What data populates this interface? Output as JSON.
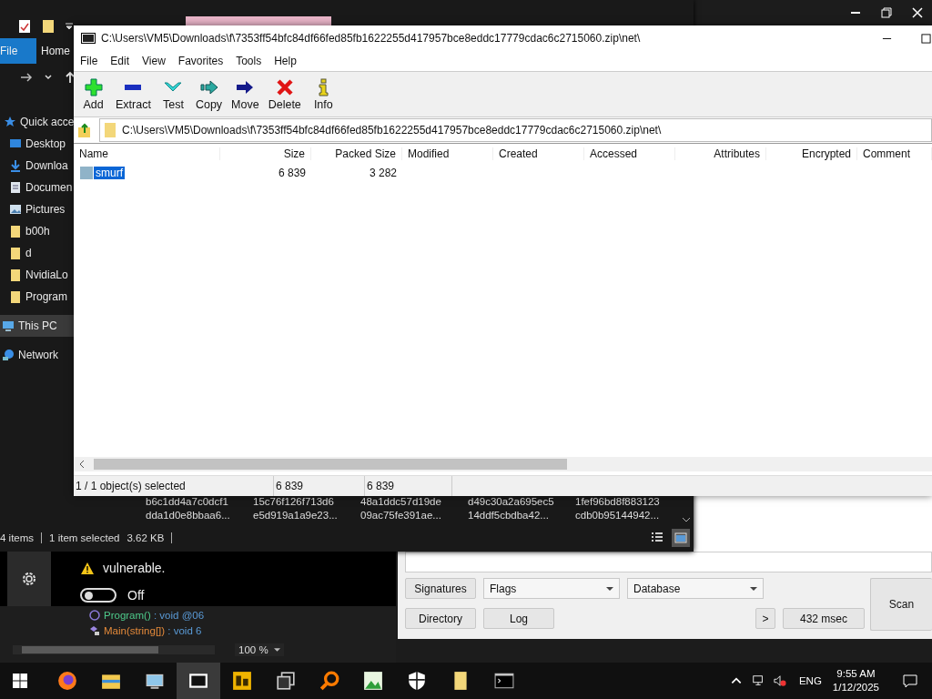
{
  "explorer": {
    "ribbon_tabs": [
      {
        "label": "File",
        "selected": true
      },
      {
        "label": "Home",
        "selected": false
      }
    ],
    "nav_items": [
      {
        "label": "Quick acce",
        "kind": "star",
        "selected": false
      },
      {
        "label": "Desktop",
        "kind": "desktop",
        "selected": false
      },
      {
        "label": "Downloa",
        "kind": "download",
        "selected": false
      },
      {
        "label": "Documen",
        "kind": "document",
        "selected": false
      },
      {
        "label": "Pictures",
        "kind": "pictures",
        "selected": false
      },
      {
        "label": "b00h",
        "kind": "folder",
        "selected": false
      },
      {
        "label": "d",
        "kind": "folder",
        "selected": false
      },
      {
        "label": "NvidiaLo",
        "kind": "folder",
        "selected": false
      },
      {
        "label": "Program",
        "kind": "folder",
        "selected": false
      },
      {
        "label": "This PC",
        "kind": "pc",
        "selected": true
      },
      {
        "label": "Network",
        "kind": "network",
        "selected": false
      }
    ],
    "hash_rows": [
      [
        "b6c1dd4a7c0dcf1",
        "15c76f126f713d6",
        "48a1ddc57d19de",
        "d49c30a2a695ec5",
        "1fef96bd8f883123"
      ],
      [
        "dda1d0e8bbaa6...",
        "e5d919a1a9e23...",
        "09ac75fe391ae...",
        "14ddf5cbdba42...",
        "cdb0b95144942..."
      ]
    ],
    "status_bar": {
      "items": "4 items",
      "selection": "1 item selected",
      "size": "3.62 KB"
    }
  },
  "sevenzip": {
    "title": "C:\\Users\\VM5\\Downloads\\f\\7353ff54bfc84df66fed85fb1622255d417957bce8eddc17779cdac6c2715060.zip\\net\\",
    "menu": [
      "File",
      "Edit",
      "View",
      "Favorites",
      "Tools",
      "Help"
    ],
    "toolbar": [
      {
        "label": "Add",
        "kind": "add"
      },
      {
        "label": "Extract",
        "kind": "extract"
      },
      {
        "label": "Test",
        "kind": "test"
      },
      {
        "label": "Copy",
        "kind": "copy"
      },
      {
        "label": "Move",
        "kind": "move"
      },
      {
        "label": "Delete",
        "kind": "delete"
      },
      {
        "label": "Info",
        "kind": "info"
      }
    ],
    "address": "C:\\Users\\VM5\\Downloads\\f\\7353ff54bfc84df66fed85fb1622255d417957bce8eddc17779cdac6c2715060.zip\\net\\",
    "columns": [
      "Name",
      "Size",
      "Packed Size",
      "Modified",
      "Created",
      "Accessed",
      "Attributes",
      "Encrypted",
      "Comment"
    ],
    "rows": [
      {
        "name": "smurf",
        "size": "6 839",
        "packed_size": "3 282",
        "selected": true
      }
    ],
    "status_bar": [
      "1 / 1 object(s) selected",
      "6 839",
      "6 839"
    ]
  },
  "defender": {
    "message": "vulnerable.",
    "toggle": {
      "label": "Off",
      "on": false
    }
  },
  "editor": {
    "lines": [
      {
        "name": "Program()",
        "signature": " : void @06",
        "kind": "constructor"
      },
      {
        "name": "Main(string[])",
        "signature": " : void 6",
        "kind": "method"
      }
    ],
    "zoom": "100 %"
  },
  "scanner": {
    "signatures": "Signatures",
    "flags": "Flags",
    "database": "Database",
    "directory": "Directory",
    "log": "Log",
    "more": ">",
    "timing": "432 msec",
    "scan": "Scan"
  },
  "taskbar": {
    "apps": [
      {
        "kind": "firefox",
        "active": false
      },
      {
        "kind": "explorer",
        "active": false
      },
      {
        "kind": "remote",
        "active": false
      },
      {
        "kind": "archive",
        "active": true
      },
      {
        "kind": "decompiler",
        "active": false
      },
      {
        "kind": "windows",
        "active": false
      },
      {
        "kind": "search",
        "active": false
      },
      {
        "kind": "image",
        "active": false
      },
      {
        "kind": "shield",
        "active": false
      },
      {
        "kind": "folder",
        "active": false
      },
      {
        "kind": "terminal",
        "active": false
      }
    ],
    "language": "ENG",
    "time": "9:55 AM",
    "date": "1/12/2025"
  }
}
